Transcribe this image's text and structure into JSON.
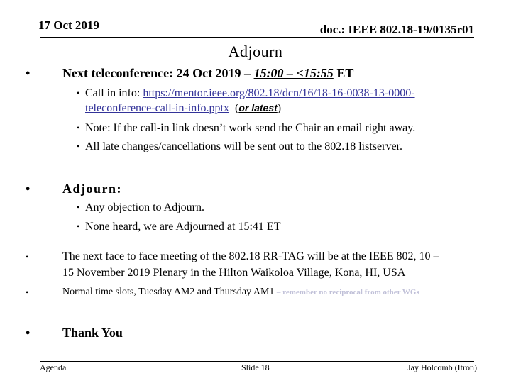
{
  "header": {
    "date": "17 Oct 2019",
    "doc_id": "doc.: IEEE 802.18-19/0135r01"
  },
  "title": "Adjourn",
  "sections": {
    "teleconference": {
      "label": "Next teleconference: 24 Oct 2019 – ",
      "time_range": "15:00 – <15:55",
      "tz": " ET",
      "sub": {
        "call_in_prefix": "Call in info: ",
        "call_in_link_line1": "https://mentor.ieee.org/802.18/dcn/16/18-16-0038-13-0000-",
        "call_in_link_line2": "teleconference-call-in-info.pptx",
        "call_in_suffix_open": "(",
        "call_in_suffix_emph": "or latest",
        "call_in_suffix_close": ")",
        "note": "Note: If the call-in link doesn’t work send the Chair an email right away.",
        "late_changes": "All late changes/cancellations will be sent out to the 802.18 listserver."
      }
    },
    "adjourn": {
      "label": "Adjourn:",
      "items": [
        "Any objection to Adjourn.",
        "None heard, we are Adjourned at  15:41 ET"
      ]
    },
    "face_to_face": {
      "line1": "The next face to face meeting of the 802.18 RR-TAG will be at the IEEE 802, 10 –",
      "line2": "15 November 2019 Plenary in the Hilton Waikoloa Village, Kona, HI, USA"
    },
    "time_slots": {
      "text": "Normal time slots, Tuesday AM2 and Thursday AM1 ",
      "note": "– remember no reciprocal from other WGs"
    },
    "thanks": "Thank You"
  },
  "bullet_glyph": "•",
  "footer": {
    "left": "Agenda",
    "center": "Slide 18",
    "right": "Jay Holcomb (Itron)"
  },
  "colors": {
    "link": "#333399",
    "faded_note": "#c0c0d8"
  }
}
